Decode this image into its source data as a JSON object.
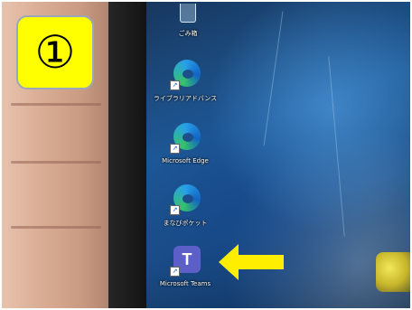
{
  "step_badge": {
    "text": "①",
    "color": "#ffff00"
  },
  "desktop": {
    "icons": [
      {
        "label": "ごみ箱",
        "icon": "recycle-bin-icon"
      },
      {
        "label": "ライブラリアドバンス",
        "icon": "edge-icon"
      },
      {
        "label": "Microsoft Edge",
        "icon": "edge-icon"
      },
      {
        "label": "まなびポケット",
        "icon": "edge-icon"
      },
      {
        "label": "Microsoft Teams",
        "icon": "teams-icon"
      }
    ],
    "shortcut_glyph": "↗",
    "teams_glyph": "T"
  },
  "pointer": {
    "icon": "arrow-left-icon",
    "color": "#ffee00"
  }
}
